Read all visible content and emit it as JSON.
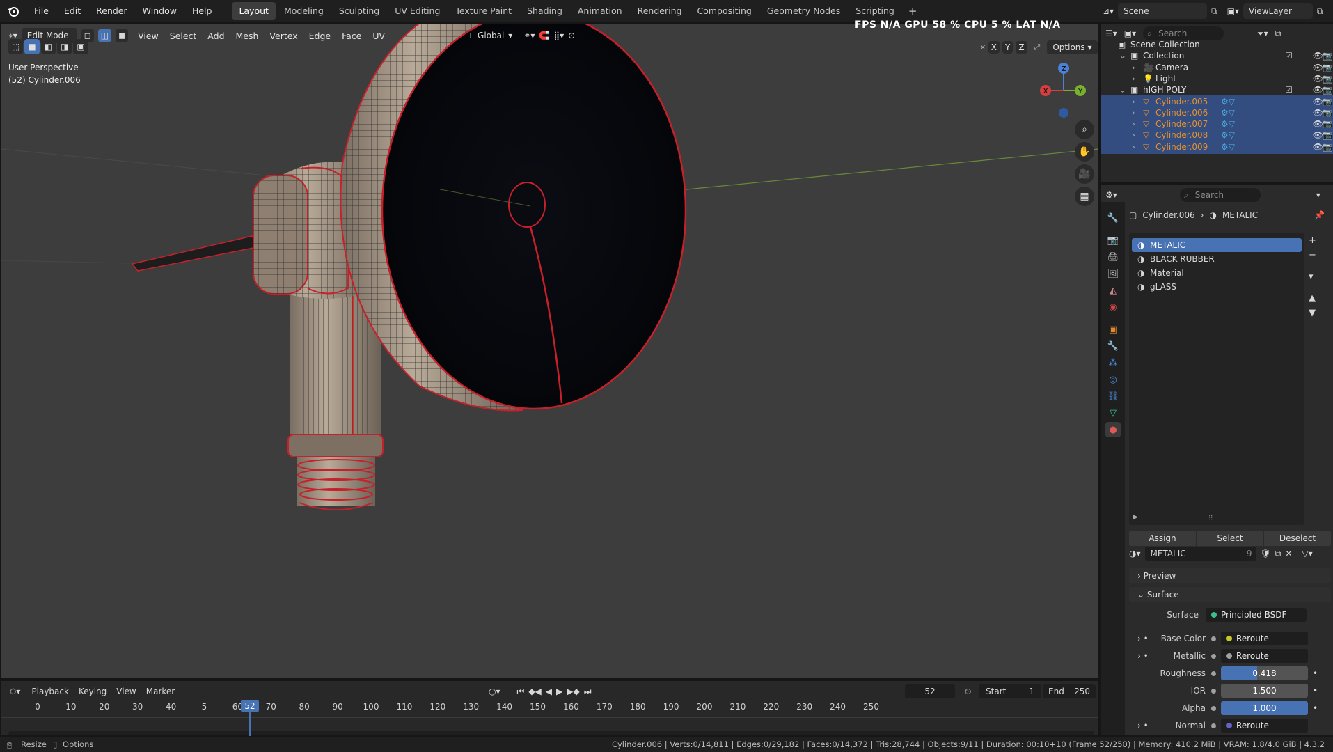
{
  "menu": [
    "File",
    "Edit",
    "Render",
    "Window",
    "Help"
  ],
  "workspaces": [
    "Layout",
    "Modeling",
    "Sculpting",
    "UV Editing",
    "Texture Paint",
    "Shading",
    "Animation",
    "Rendering",
    "Compositing",
    "Geometry Nodes",
    "Scripting"
  ],
  "active_workspace": "Layout",
  "scene": {
    "label": "Scene",
    "view_layer": "ViewLayer"
  },
  "viewport": {
    "mode": "Edit Mode",
    "menus": [
      "View",
      "Select",
      "Add",
      "Mesh",
      "Vertex",
      "Edge",
      "Face",
      "UV"
    ],
    "orientation": "Global",
    "options": "Options",
    "perspective": "User Perspective",
    "object": "(52) Cylinder.006",
    "stats": "FPS  N/A  GPU  58 %  CPU  5 %  LAT  N/A",
    "axes": {
      "z": "Z",
      "y": "Y",
      "x": "X"
    },
    "mirror_axes": [
      "X",
      "Y",
      "Z"
    ]
  },
  "outliner": {
    "search": "Search",
    "rows": [
      {
        "name": "Scene Collection",
        "indent": 0,
        "sel": false,
        "kind": "scene"
      },
      {
        "name": "Collection",
        "indent": 1,
        "sel": false,
        "kind": "collection"
      },
      {
        "name": "Camera",
        "indent": 2,
        "sel": false,
        "kind": "camera"
      },
      {
        "name": "Light",
        "indent": 2,
        "sel": false,
        "kind": "light"
      },
      {
        "name": "hIGH POLY",
        "indent": 1,
        "sel": false,
        "kind": "collection"
      },
      {
        "name": "Cylinder.005",
        "indent": 2,
        "sel": true,
        "kind": "mesh"
      },
      {
        "name": "Cylinder.006",
        "indent": 2,
        "sel": true,
        "kind": "mesh"
      },
      {
        "name": "Cylinder.007",
        "indent": 2,
        "sel": true,
        "kind": "mesh"
      },
      {
        "name": "Cylinder.008",
        "indent": 2,
        "sel": true,
        "kind": "mesh"
      },
      {
        "name": "Cylinder.009",
        "indent": 2,
        "sel": true,
        "kind": "mesh"
      }
    ]
  },
  "properties": {
    "search": "Search",
    "breadcrumb_object": "Cylinder.006",
    "breadcrumb_material": "METALIC",
    "materials": [
      "METALIC",
      "BLACK RUBBER",
      "Material",
      "gLASS"
    ],
    "buttons": {
      "assign": "Assign",
      "select": "Select",
      "deselect": "Deselect"
    },
    "material_name": "METALIC",
    "user_count": "9",
    "preview": "Preview",
    "surface_section": "Surface",
    "surface": {
      "label": "Surface",
      "value": "Principled BSDF"
    },
    "fields": [
      {
        "label": "Base Color",
        "value": "Reroute",
        "type": "link",
        "color": "#c7c729"
      },
      {
        "label": "Metallic",
        "value": "Reroute",
        "type": "link",
        "color": "#a1a1a1"
      },
      {
        "label": "Roughness",
        "value": "0.418",
        "type": "num",
        "fill": 0.418
      },
      {
        "label": "IOR",
        "value": "1.500",
        "type": "num",
        "fill": 0
      },
      {
        "label": "Alpha",
        "value": "1.000",
        "type": "num",
        "fill": 1
      },
      {
        "label": "Normal",
        "value": "Reroute",
        "type": "link",
        "color": "#6363c7"
      }
    ]
  },
  "timeline": {
    "menus": [
      "Playback",
      "Keying",
      "View",
      "Marker"
    ],
    "current_frame": "52",
    "start_label": "Start",
    "start": "1",
    "end_label": "End",
    "end": "250",
    "ticks": [
      "0",
      "10",
      "20",
      "30",
      "40",
      "5",
      "60",
      "70",
      "80",
      "90",
      "100",
      "110",
      "120",
      "130",
      "140",
      "150",
      "160",
      "170",
      "180",
      "190",
      "200",
      "210",
      "220",
      "230",
      "240",
      "250"
    ]
  },
  "status": {
    "left1": "Resize",
    "left2": "Options",
    "right": "Cylinder.006 | Verts:0/14,811 | Edges:0/29,182 | Faces:0/14,372 | Tris:28,744 | Objects:9/11 | Duration: 00:10+10 (Frame 52/250) | Memory: 410.2 MiB | VRAM: 1.8/4.0 GiB | 4.3.2"
  }
}
